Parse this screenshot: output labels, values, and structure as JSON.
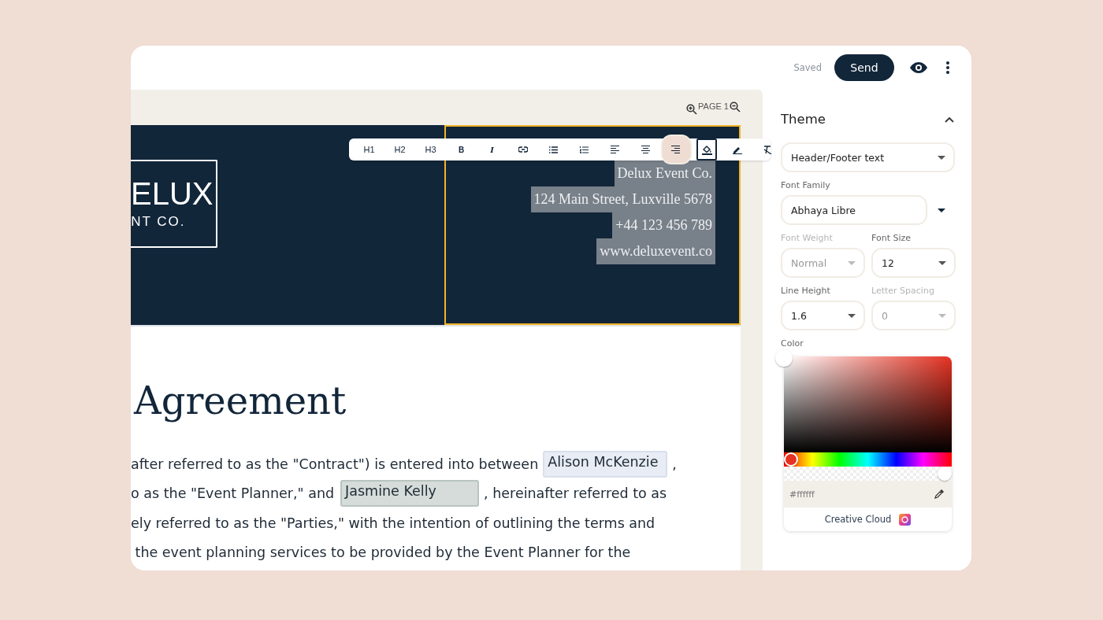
{
  "top_bar": {
    "status": "Saved",
    "send_button": "Send"
  },
  "page_label": "PAGE 1",
  "toolbar": [
    {
      "kind": "text",
      "label": "H1",
      "selected": false,
      "focused": false
    },
    {
      "kind": "text",
      "label": "H2",
      "selected": false,
      "focused": false
    },
    {
      "kind": "text",
      "label": "H3",
      "selected": false,
      "focused": false
    },
    {
      "kind": "bold",
      "label": "B",
      "selected": false,
      "focused": false
    },
    {
      "kind": "italic",
      "label": "I",
      "selected": false,
      "focused": false
    },
    {
      "kind": "link",
      "selected": false,
      "focused": false
    },
    {
      "kind": "bullets",
      "selected": false,
      "focused": false
    },
    {
      "kind": "numbers",
      "selected": false,
      "focused": false
    },
    {
      "kind": "align-left",
      "selected": false,
      "focused": false
    },
    {
      "kind": "align-center",
      "selected": false,
      "focused": false
    },
    {
      "kind": "align-right",
      "selected": true,
      "focused": false
    },
    {
      "kind": "fill",
      "selected": false,
      "focused": true
    },
    {
      "kind": "pen",
      "selected": false,
      "focused": false
    },
    {
      "kind": "clear",
      "selected": false,
      "focused": false
    }
  ],
  "header": {
    "logo_lines": [
      "ELUX",
      "NT CO."
    ],
    "selected": true,
    "address_lines": [
      "Delux Event Co.",
      "124 Main Street, Luxville 5678",
      "+44 123 456 789",
      "www.deluxevent.co"
    ]
  },
  "heading": "Agreement",
  "paragraph_lines": [
    {
      "text": "after referred to as the \"Contract\") is entered into between",
      "field": {
        "value": "Alison McKenzie",
        "kind": "signer-1"
      },
      "after": ","
    },
    {
      "text": "o as the \"Event Planner,\" and",
      "field": {
        "value": "Jasmine Kelly",
        "kind": "signer-2"
      },
      "after": ", hereinafter referred to as"
    },
    {
      "text": "ely referred to as the \"Parties,\" with the intention of outlining the terms and"
    },
    {
      "text": " the event planning services to be provided by the Event Planner for the"
    }
  ],
  "sidebar": {
    "title": "Theme",
    "expanded": true,
    "target_select": "Header/Footer text",
    "font_family": {
      "label": "Font Family",
      "value": "Abhaya Libre"
    },
    "fields": [
      {
        "label": "Font Weight",
        "value": "Normal",
        "disabled": true
      },
      {
        "label": "Font Size",
        "value": "12",
        "disabled": false
      },
      {
        "label": "Line Height",
        "value": "1.6",
        "disabled": false
      },
      {
        "label": "Letter Spacing",
        "value": "0",
        "disabled": true
      }
    ],
    "color": {
      "label": "Color",
      "hue_slider": {
        "level": 0
      },
      "alpha_slider": {
        "level": 1
      },
      "hex": "#ffffff",
      "library": "Creative Cloud"
    }
  }
}
